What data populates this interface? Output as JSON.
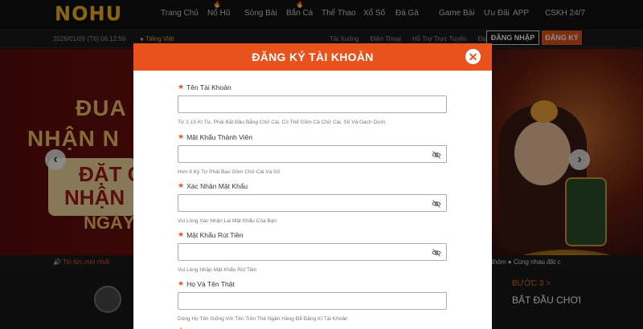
{
  "site": {
    "logo": "NOHU"
  },
  "nav": {
    "items": [
      "Trang Chủ",
      "Nổ Hũ",
      "Sòng Bài",
      "Bắn Cá",
      "Thể Thao",
      "Xổ Số",
      "Đá Gà",
      "Game Bài",
      "Ưu Đãi",
      "APP",
      "CSKH 24/7"
    ]
  },
  "subbar": {
    "datetime": "2026/01/09 (T6) 06:12:56",
    "language": "Tiếng Việt",
    "links": [
      "Tải Xuống",
      "Điện Thoại",
      "Hỗ Trợ Trực Tuyến",
      "Đại Lý"
    ],
    "login_label": "ĐĂNG NHẬP",
    "register_label": "ĐĂNG KÝ"
  },
  "hero": {
    "line1": "ĐUA",
    "line2": "NHẬN N",
    "line3": "ĐẶT C",
    "line4": "NHẬN",
    "line5": "NGÀY",
    "prev_icon": "‹",
    "next_icon": "›"
  },
  "ticker": {
    "label": "Tin tức mới nhất",
    "text": "Đội Nhóm ● Cùng nhau đặt c"
  },
  "bottom": {
    "step_label": "BƯỚC 3 >",
    "step_title": "BẮT ĐẦU CHƠI"
  },
  "modal": {
    "title": "ĐĂNG KÝ TÀI KHOẢN",
    "close_icon": "✕",
    "fields": [
      {
        "label": "Tên Tài Khoản",
        "value": "",
        "hint": "Từ 2-15 Kí Tự, Phải Bắt Đầu Bằng Chữ Cái, Có Thể Gồm Cả Chữ Cái, Số Và Gạch Dưới."
      },
      {
        "label": "Mật Khẩu Thành Viên",
        "value": "",
        "hint": "Hơn 6 Ký Tự Phải Bao Gồm Chữ Cái Và Số"
      },
      {
        "label": "Xác Nhận Mật Khẩu",
        "value": "",
        "hint": "Vui Lòng Xác Nhận Lại Mật Khẩu Của Bạn"
      },
      {
        "label": "Mật Khẩu Rút Tiền",
        "value": "",
        "hint": "Vui Lòng Nhập Mật Khẩu Rút Tiền"
      },
      {
        "label": "Họ Và Tên Thật",
        "value": "",
        "hint": "Dùng Họ Tên Giống Với Tên Trên Thẻ Ngân Hàng Để Đăng Kí Tài Khoản"
      }
    ]
  },
  "colors": {
    "accent": "#e8531d",
    "logo_gold": "#f6b62a"
  }
}
